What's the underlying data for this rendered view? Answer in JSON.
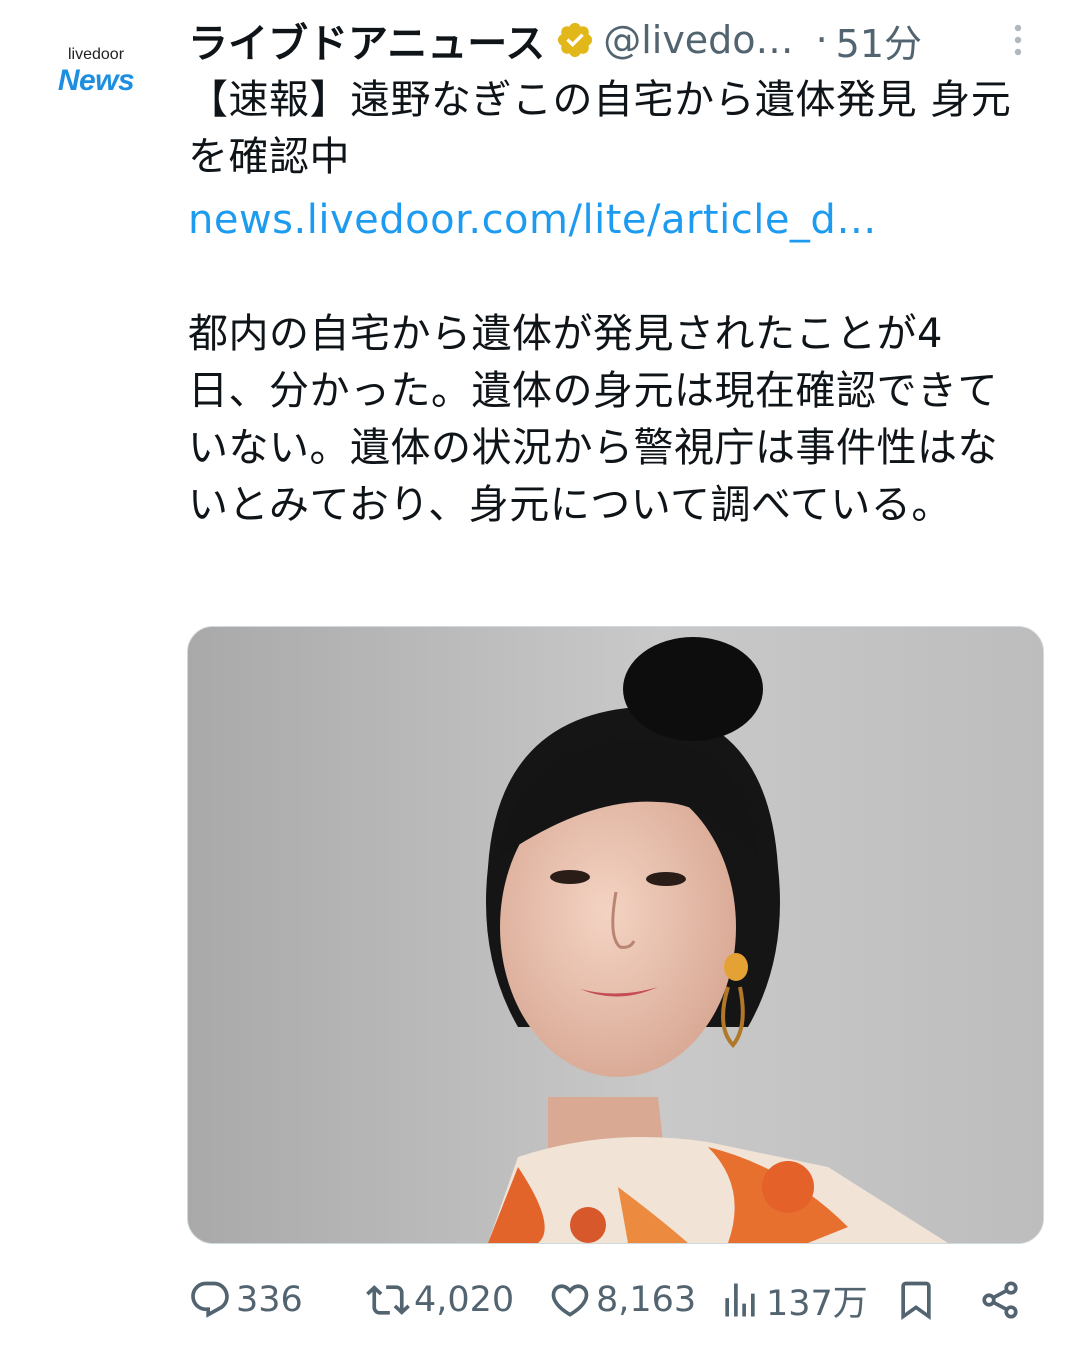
{
  "account": {
    "logo_top": "livedoor",
    "logo_main": "News",
    "display_name": "ライブドアニュース",
    "handle": "@livedo…",
    "separator": "·",
    "time_ago": "51分"
  },
  "tweet": {
    "headline": "【速報】遠野なぎこの自宅から遺体発見 身元を確認中",
    "link_text": "news.livedoor.com/lite/article_d…",
    "body": "都内の自宅から遺体が発見されたことが4日、分かった。遺体の身元は現在確認できていない。遺体の状況から警視庁は事件性はないとみており、身元について調べている。"
  },
  "actions": {
    "replies": "336",
    "reposts": "4,020",
    "likes": "8,163",
    "views": "137万"
  },
  "colors": {
    "text": "#0f1419",
    "secondary": "#536471",
    "link": "#1d9bf0",
    "verified_badge": "#e2b719",
    "logo_blue": "#1d8fe1"
  },
  "icons": {
    "verified": "verified-badge-icon",
    "more": "more-vertical-icon",
    "reply": "reply-icon",
    "repost": "repost-icon",
    "like": "heart-icon",
    "views": "views-chart-icon",
    "bookmark": "bookmark-icon",
    "share": "share-icon"
  }
}
